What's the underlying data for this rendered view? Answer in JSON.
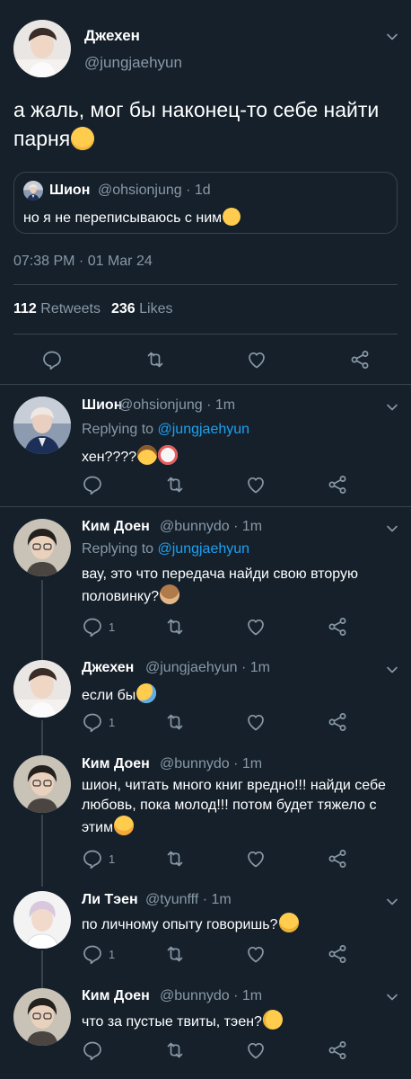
{
  "main_tweet": {
    "display_name": "Джехен",
    "handle": "@jungjaehyun",
    "text": "а жаль, мог бы наконец-то себе найти парня",
    "text_emoji": "pensive-face",
    "quote": {
      "display_name": "Шион",
      "handle": "@ohsionjung",
      "time": "· 1d",
      "text": "но я не переписываюсь с ним",
      "text_emoji": "face-with-rolling-eyes"
    },
    "timestamp": "07:38 PM · 01 Mar 24",
    "retweets_count": "112",
    "retweets_label": "Retweets",
    "likes_count": "236",
    "likes_label": "Likes"
  },
  "replies": [
    {
      "display_name": "Шион",
      "handle": "@ohsionjung",
      "time": "· 1m",
      "replying_to_label": "Replying to",
      "replying_to_handle": "@jungjaehyun",
      "text": "хен????",
      "emojis": [
        "cowboy-face",
        "clown-face"
      ],
      "reply_count": ""
    },
    {
      "display_name": "Ким Доен",
      "handle": "@bunnydo",
      "time": "· 1m",
      "replying_to_label": "Replying to",
      "replying_to_handle": "@jungjaehyun",
      "text": "вау, это что передача найди свою вторую половинку?",
      "emojis": [
        "see-no-evil-monkey"
      ],
      "reply_count": "1"
    },
    {
      "display_name": "Джехен",
      "handle": "@jungjaehyun",
      "time": "· 1m",
      "text": "если бы",
      "emojis": [
        "sad-sweat-face"
      ],
      "reply_count": "1"
    },
    {
      "display_name": "Ким Доен",
      "handle": "@bunnydo",
      "time": "· 1m",
      "text": "шион, читать много книг вредно!!! найди себе любовь, пока молод!!! потом будет тяжело с этим",
      "emojis": [
        "hugging-face"
      ],
      "reply_count": "1"
    },
    {
      "display_name": "Ли Тэен",
      "handle": "@tyunfff",
      "time": "· 1m",
      "text": "по личному опыту говоришь?",
      "emojis": [
        "smirking-face"
      ],
      "reply_count": "1"
    },
    {
      "display_name": "Ким Доен",
      "handle": "@bunnydo",
      "time": "· 1m",
      "text": "что за пустые твиты, тэен?",
      "emojis": [
        "face-with-monocle"
      ],
      "reply_count": ""
    }
  ],
  "colors": {
    "background": "#15202b",
    "border": "#38444d",
    "muted_text": "#8899a6",
    "link": "#1da1f2",
    "text": "#ffffff"
  }
}
